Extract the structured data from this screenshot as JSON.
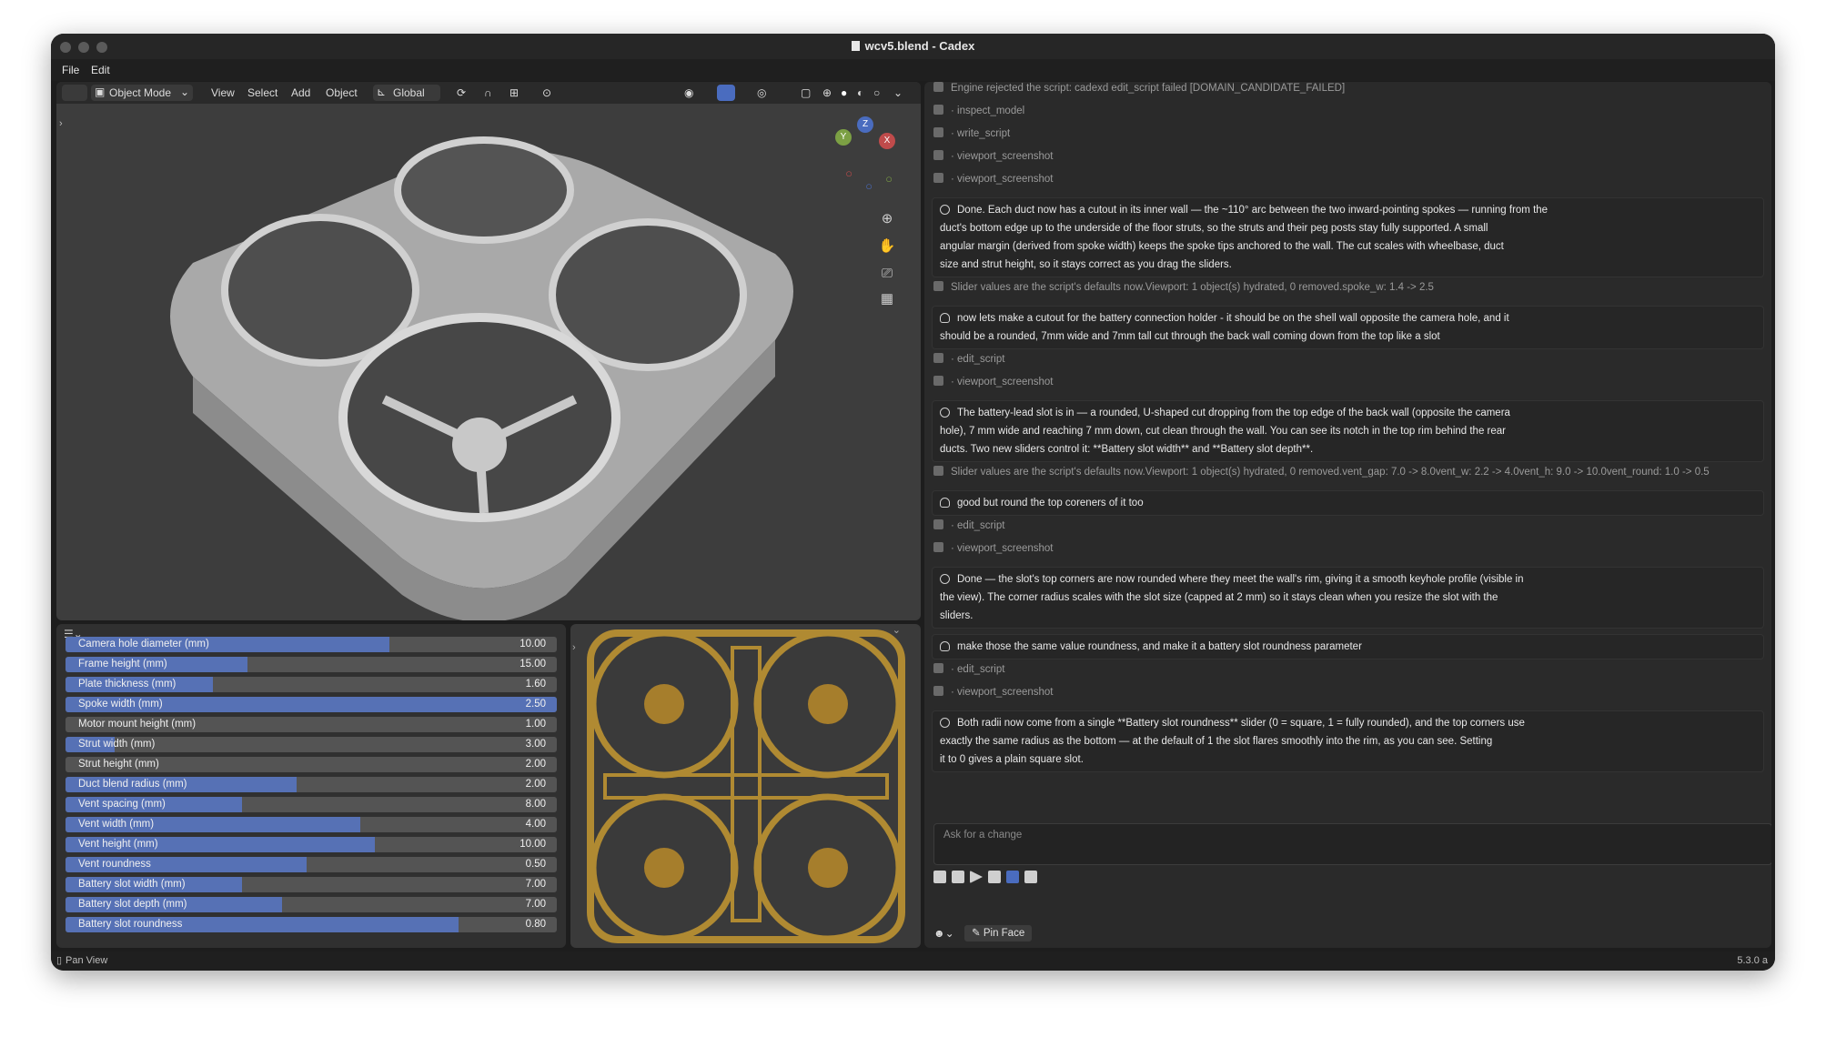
{
  "window": {
    "title": "wcv5.blend - Cadex"
  },
  "menubar": {
    "items": [
      "File",
      "Edit"
    ]
  },
  "viewport_header": {
    "mode": "Object Mode",
    "menus": [
      "View",
      "Select",
      "Add",
      "Object"
    ],
    "orientation": "Global"
  },
  "gizmo": {
    "z": "Z",
    "y": "Y",
    "x": "X"
  },
  "properties": {
    "sliders": [
      {
        "label": "Camera hole diameter (mm)",
        "value": "10.00",
        "level": 0.66
      },
      {
        "label": "Frame height (mm)",
        "value": "15.00",
        "level": 0.37
      },
      {
        "label": "Plate thickness (mm)",
        "value": "1.60",
        "level": 0.3
      },
      {
        "label": "Spoke width (mm)",
        "value": "2.50",
        "level": 1.0
      },
      {
        "label": "Motor mount height (mm)",
        "value": "1.00",
        "level": 0.0
      },
      {
        "label": "Strut width (mm)",
        "value": "3.00",
        "level": 0.1
      },
      {
        "label": "Strut height (mm)",
        "value": "2.00",
        "level": 0.0
      },
      {
        "label": "Duct blend radius (mm)",
        "value": "2.00",
        "level": 0.47
      },
      {
        "label": "Vent spacing (mm)",
        "value": "8.00",
        "level": 0.36
      },
      {
        "label": "Vent width (mm)",
        "value": "4.00",
        "level": 0.6
      },
      {
        "label": "Vent height (mm)",
        "value": "10.00",
        "level": 0.63
      },
      {
        "label": "Vent roundness",
        "value": "0.50",
        "level": 0.49
      },
      {
        "label": "Battery slot width (mm)",
        "value": "7.00",
        "level": 0.36
      },
      {
        "label": "Battery slot depth (mm)",
        "value": "7.00",
        "level": 0.44
      },
      {
        "label": "Battery slot roundness",
        "value": "0.80",
        "level": 0.8
      }
    ]
  },
  "chat": {
    "entries": [
      {
        "kind": "log",
        "text": "Engine rejected the script: cadexd edit_script failed [DOMAIN_CANDIDATE_FAILED]"
      },
      {
        "kind": "log",
        "text": "· inspect_model"
      },
      {
        "kind": "log",
        "text": "· write_script"
      },
      {
        "kind": "log",
        "text": "· viewport_screenshot"
      },
      {
        "kind": "log",
        "text": "· viewport_screenshot"
      },
      {
        "kind": "assistant",
        "lines": [
          "Done. Each duct now has a cutout in its inner wall — the ~110° arc between the two inward-pointing spokes — running from the",
          "duct's bottom edge up to the underside of the floor struts, so the struts and their peg posts stay fully supported. A small",
          "angular margin (derived from spoke width) keeps the spoke tips anchored to the wall. The cut scales with wheelbase, duct",
          "size and strut height, so it stays correct as you drag the sliders."
        ]
      },
      {
        "kind": "log",
        "text": "Slider values are the script's defaults now.Viewport: 1 object(s) hydrated, 0 removed.spoke_w: 1.4 -> 2.5"
      },
      {
        "kind": "user",
        "lines": [
          "now lets make a cutout for the battery connection holder - it should be on the shell wall opposite the camera hole, and it",
          "should be a rounded, 7mm wide and 7mm tall cut through the back wall coming down from the top like a slot"
        ]
      },
      {
        "kind": "log",
        "text": "· edit_script"
      },
      {
        "kind": "log",
        "text": "· viewport_screenshot"
      },
      {
        "kind": "assistant",
        "lines": [
          "The battery-lead slot is in — a rounded, U-shaped cut dropping from the top edge of the back wall (opposite the camera",
          "hole), 7 mm wide and reaching 7 mm down, cut clean through the wall. You can see its notch in the top rim behind the rear",
          "ducts. Two new sliders control it: **Battery slot width** and **Battery slot depth**."
        ]
      },
      {
        "kind": "log",
        "text": "Slider values are the script's defaults now.Viewport: 1 object(s) hydrated, 0 removed.vent_gap: 7.0 -> 8.0vent_w: 2.2 -> 4.0vent_h: 9.0 -> 10.0vent_round: 1.0 -> 0.5"
      },
      {
        "kind": "user",
        "lines": [
          "good but round the top coreners of it too"
        ]
      },
      {
        "kind": "log",
        "text": "· edit_script"
      },
      {
        "kind": "log",
        "text": "· viewport_screenshot"
      },
      {
        "kind": "assistant",
        "lines": [
          "Done — the slot's top corners are now rounded where they meet the wall's rim, giving it a smooth keyhole profile (visible in",
          "the view). The corner radius scales with the slot size (capped at 2 mm) so it stays clean when you resize the slot with the",
          "sliders."
        ]
      },
      {
        "kind": "user",
        "lines": [
          "make those the same value roundness, and make it a battery slot roundness parameter"
        ]
      },
      {
        "kind": "log",
        "text": "· edit_script"
      },
      {
        "kind": "log",
        "text": "· viewport_screenshot"
      },
      {
        "kind": "assistant",
        "lines": [
          "Both radii now come from a single **Battery slot roundness** slider (0 = square, 1 = fully rounded), and the top corners use",
          "exactly the same radius as the bottom — at the default of 1 the slot flares smoothly into the rim, as you can see. Setting",
          "it to 0 gives a plain square slot."
        ]
      }
    ],
    "input_placeholder": "Ask for a change",
    "pin_face_label": "Pin Face"
  },
  "status": {
    "left": "Pan View",
    "right": "5.3.0 a"
  }
}
